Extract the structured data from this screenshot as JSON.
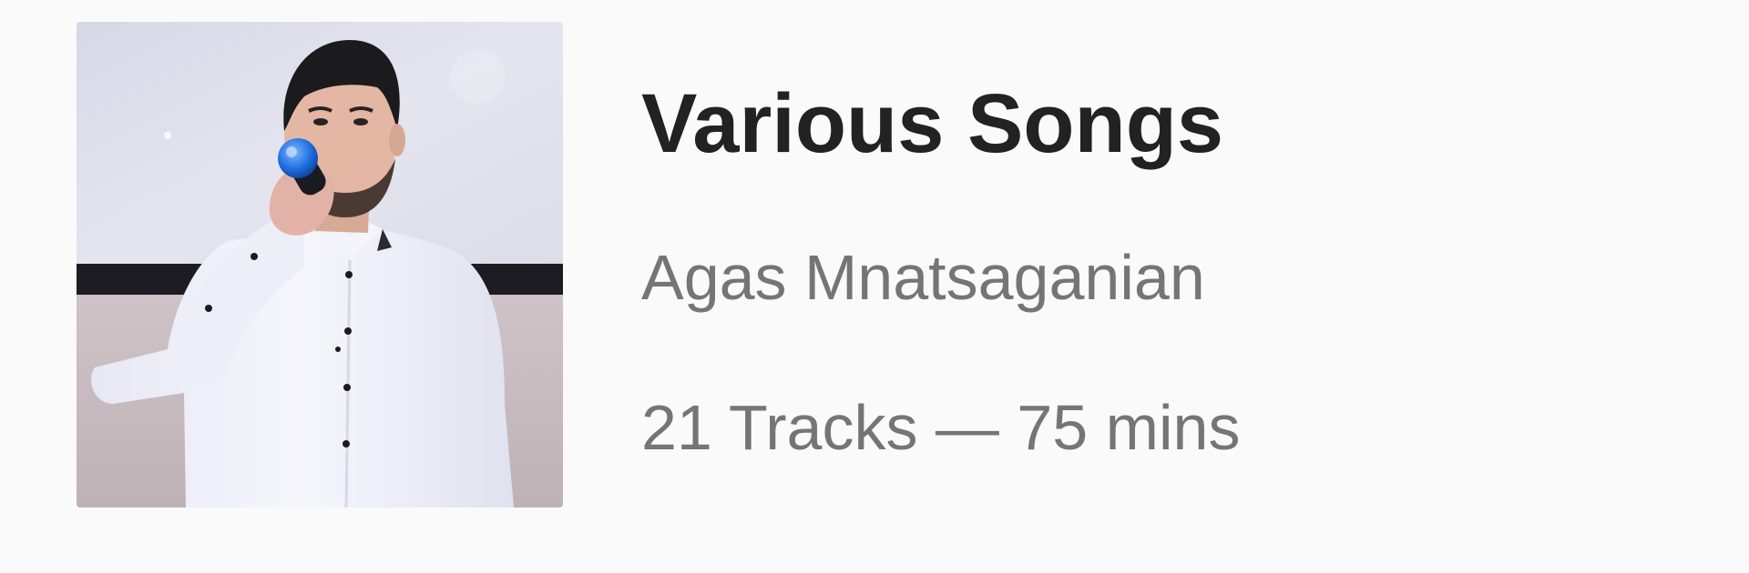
{
  "album": {
    "title": "Various Songs",
    "artist": "Agas Mnatsaganian",
    "track_count": "21 Tracks",
    "separator": "—",
    "duration": "75 mins",
    "cover_image": "singer-with-microphone-photo"
  },
  "colors": {
    "background": "#fafafa",
    "title_text": "#222222",
    "secondary_text": "#757575"
  }
}
